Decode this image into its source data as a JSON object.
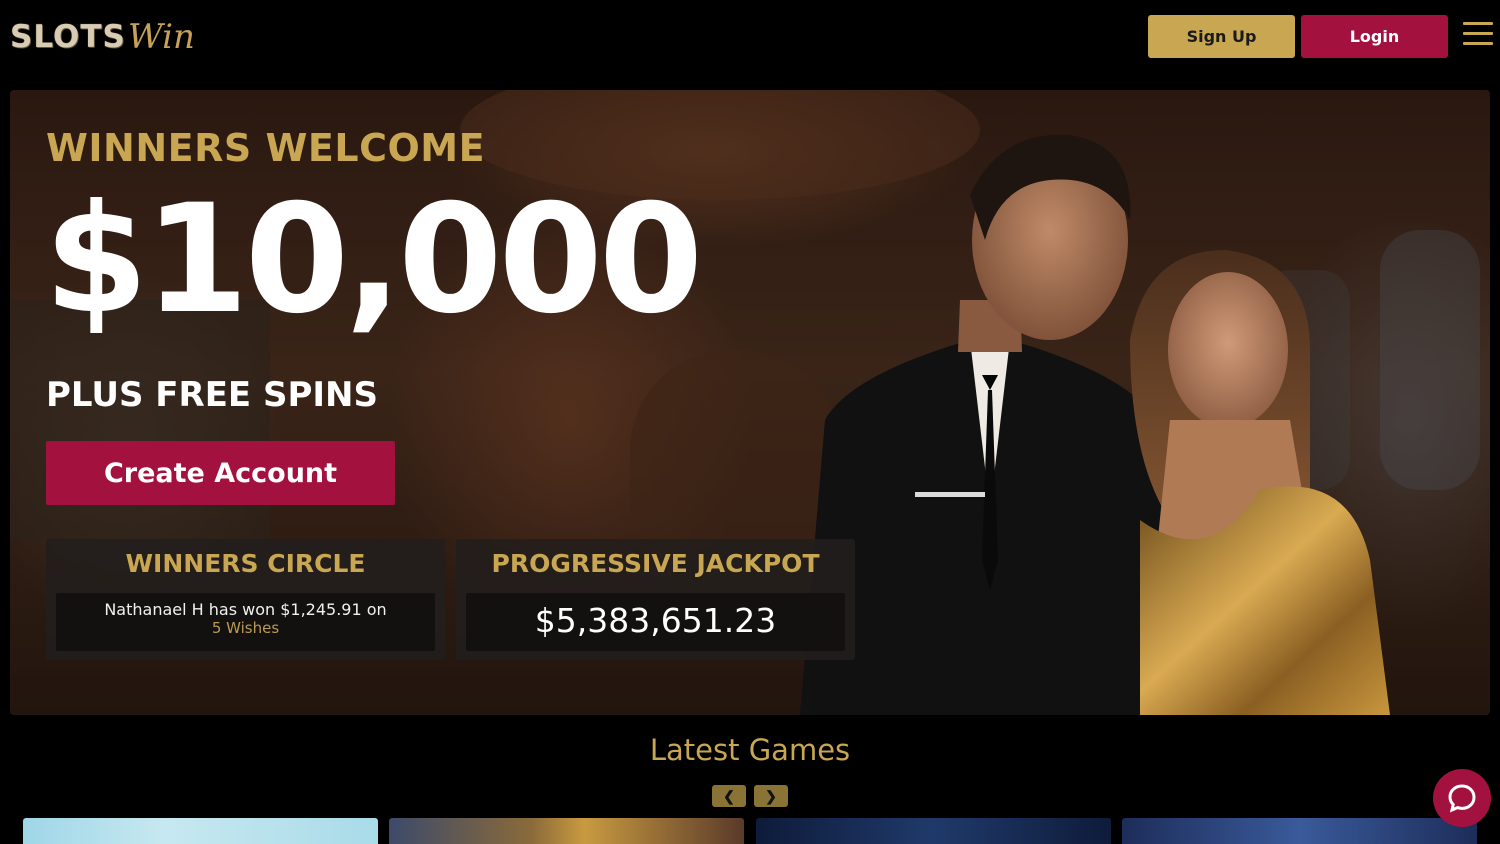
{
  "header": {
    "logo_text_a": "SLOTS",
    "logo_text_b": "Win",
    "signup_label": "Sign Up",
    "login_label": "Login",
    "menu_icon": "hamburger-menu-icon"
  },
  "hero": {
    "kicker": "WINNERS WELCOME",
    "amount": "$10,000",
    "subheading": "PLUS FREE SPINS",
    "cta_label": "Create Account",
    "winners_circle": {
      "title": "WINNERS CIRCLE",
      "message": "Nathanael H has won $1,245.91 on",
      "game": "5 Wishes"
    },
    "jackpot": {
      "title": "PROGRESSIVE JACKPOT",
      "value": "$5,383,651.23"
    }
  },
  "latest_games": {
    "title": "Latest Games",
    "prev_icon": "chevron-left-icon",
    "next_icon": "chevron-right-icon"
  },
  "chat": {
    "icon": "chat-bubble-icon"
  },
  "colors": {
    "gold": "#c8a652",
    "crimson": "#a3123f",
    "background": "#000000"
  }
}
